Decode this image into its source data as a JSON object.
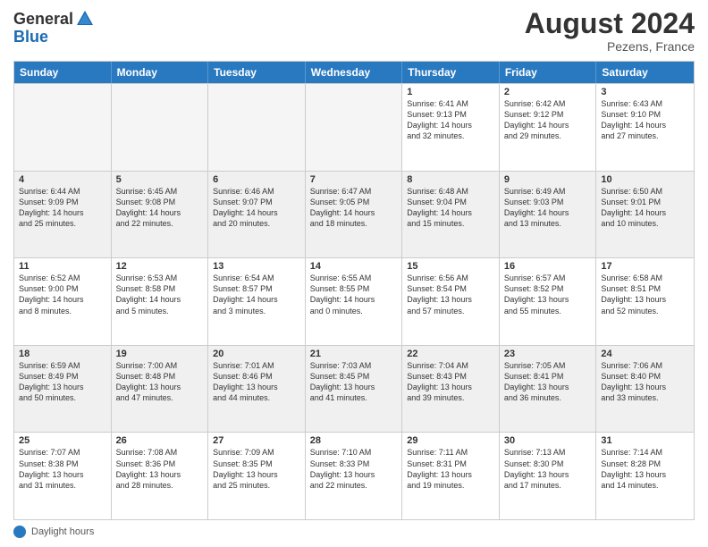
{
  "header": {
    "logo_general": "General",
    "logo_blue": "Blue",
    "month_year": "August 2024",
    "location": "Pezens, France"
  },
  "weekdays": [
    "Sunday",
    "Monday",
    "Tuesday",
    "Wednesday",
    "Thursday",
    "Friday",
    "Saturday"
  ],
  "rows": [
    [
      {
        "day": "",
        "info": "",
        "empty": true
      },
      {
        "day": "",
        "info": "",
        "empty": true
      },
      {
        "day": "",
        "info": "",
        "empty": true
      },
      {
        "day": "",
        "info": "",
        "empty": true
      },
      {
        "day": "1",
        "info": "Sunrise: 6:41 AM\nSunset: 9:13 PM\nDaylight: 14 hours\nand 32 minutes."
      },
      {
        "day": "2",
        "info": "Sunrise: 6:42 AM\nSunset: 9:12 PM\nDaylight: 14 hours\nand 29 minutes."
      },
      {
        "day": "3",
        "info": "Sunrise: 6:43 AM\nSunset: 9:10 PM\nDaylight: 14 hours\nand 27 minutes."
      }
    ],
    [
      {
        "day": "4",
        "info": "Sunrise: 6:44 AM\nSunset: 9:09 PM\nDaylight: 14 hours\nand 25 minutes."
      },
      {
        "day": "5",
        "info": "Sunrise: 6:45 AM\nSunset: 9:08 PM\nDaylight: 14 hours\nand 22 minutes."
      },
      {
        "day": "6",
        "info": "Sunrise: 6:46 AM\nSunset: 9:07 PM\nDaylight: 14 hours\nand 20 minutes."
      },
      {
        "day": "7",
        "info": "Sunrise: 6:47 AM\nSunset: 9:05 PM\nDaylight: 14 hours\nand 18 minutes."
      },
      {
        "day": "8",
        "info": "Sunrise: 6:48 AM\nSunset: 9:04 PM\nDaylight: 14 hours\nand 15 minutes."
      },
      {
        "day": "9",
        "info": "Sunrise: 6:49 AM\nSunset: 9:03 PM\nDaylight: 14 hours\nand 13 minutes."
      },
      {
        "day": "10",
        "info": "Sunrise: 6:50 AM\nSunset: 9:01 PM\nDaylight: 14 hours\nand 10 minutes."
      }
    ],
    [
      {
        "day": "11",
        "info": "Sunrise: 6:52 AM\nSunset: 9:00 PM\nDaylight: 14 hours\nand 8 minutes."
      },
      {
        "day": "12",
        "info": "Sunrise: 6:53 AM\nSunset: 8:58 PM\nDaylight: 14 hours\nand 5 minutes."
      },
      {
        "day": "13",
        "info": "Sunrise: 6:54 AM\nSunset: 8:57 PM\nDaylight: 14 hours\nand 3 minutes."
      },
      {
        "day": "14",
        "info": "Sunrise: 6:55 AM\nSunset: 8:55 PM\nDaylight: 14 hours\nand 0 minutes."
      },
      {
        "day": "15",
        "info": "Sunrise: 6:56 AM\nSunset: 8:54 PM\nDaylight: 13 hours\nand 57 minutes."
      },
      {
        "day": "16",
        "info": "Sunrise: 6:57 AM\nSunset: 8:52 PM\nDaylight: 13 hours\nand 55 minutes."
      },
      {
        "day": "17",
        "info": "Sunrise: 6:58 AM\nSunset: 8:51 PM\nDaylight: 13 hours\nand 52 minutes."
      }
    ],
    [
      {
        "day": "18",
        "info": "Sunrise: 6:59 AM\nSunset: 8:49 PM\nDaylight: 13 hours\nand 50 minutes."
      },
      {
        "day": "19",
        "info": "Sunrise: 7:00 AM\nSunset: 8:48 PM\nDaylight: 13 hours\nand 47 minutes."
      },
      {
        "day": "20",
        "info": "Sunrise: 7:01 AM\nSunset: 8:46 PM\nDaylight: 13 hours\nand 44 minutes."
      },
      {
        "day": "21",
        "info": "Sunrise: 7:03 AM\nSunset: 8:45 PM\nDaylight: 13 hours\nand 41 minutes."
      },
      {
        "day": "22",
        "info": "Sunrise: 7:04 AM\nSunset: 8:43 PM\nDaylight: 13 hours\nand 39 minutes."
      },
      {
        "day": "23",
        "info": "Sunrise: 7:05 AM\nSunset: 8:41 PM\nDaylight: 13 hours\nand 36 minutes."
      },
      {
        "day": "24",
        "info": "Sunrise: 7:06 AM\nSunset: 8:40 PM\nDaylight: 13 hours\nand 33 minutes."
      }
    ],
    [
      {
        "day": "25",
        "info": "Sunrise: 7:07 AM\nSunset: 8:38 PM\nDaylight: 13 hours\nand 31 minutes."
      },
      {
        "day": "26",
        "info": "Sunrise: 7:08 AM\nSunset: 8:36 PM\nDaylight: 13 hours\nand 28 minutes."
      },
      {
        "day": "27",
        "info": "Sunrise: 7:09 AM\nSunset: 8:35 PM\nDaylight: 13 hours\nand 25 minutes."
      },
      {
        "day": "28",
        "info": "Sunrise: 7:10 AM\nSunset: 8:33 PM\nDaylight: 13 hours\nand 22 minutes."
      },
      {
        "day": "29",
        "info": "Sunrise: 7:11 AM\nSunset: 8:31 PM\nDaylight: 13 hours\nand 19 minutes."
      },
      {
        "day": "30",
        "info": "Sunrise: 7:13 AM\nSunset: 8:30 PM\nDaylight: 13 hours\nand 17 minutes."
      },
      {
        "day": "31",
        "info": "Sunrise: 7:14 AM\nSunset: 8:28 PM\nDaylight: 13 hours\nand 14 minutes."
      }
    ]
  ],
  "footer": {
    "daylight_label": "Daylight hours"
  }
}
